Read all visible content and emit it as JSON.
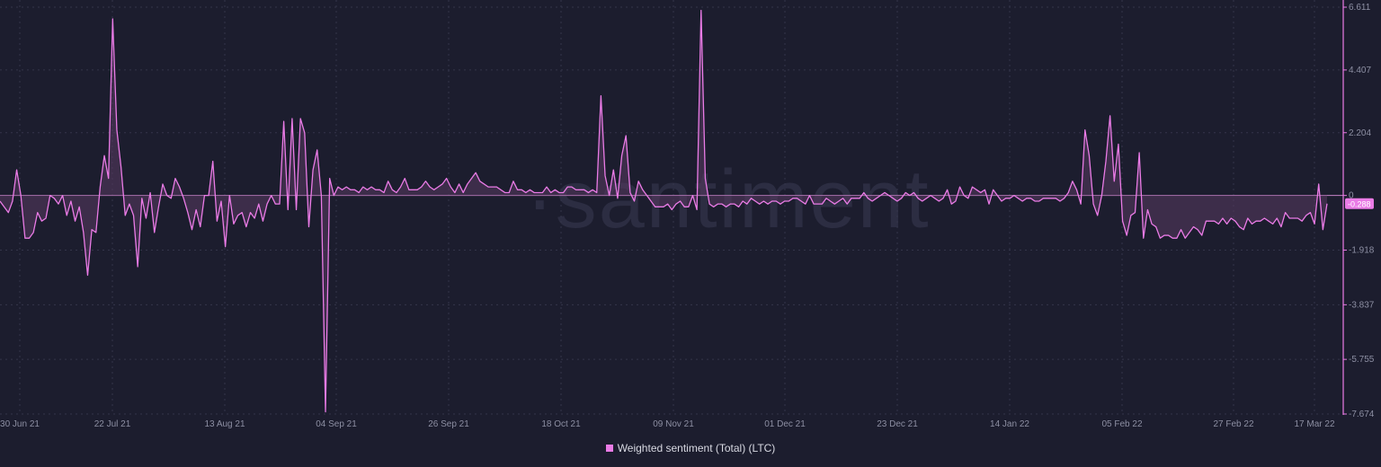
{
  "watermark": "·santiment",
  "legend": {
    "label": "Weighted sentiment (Total) (LTC)"
  },
  "colors": {
    "background": "#1c1d2e",
    "line": "#ea7be6",
    "fill": "#5a3a62",
    "grid": "#34354a",
    "zero_line": "#c583c7",
    "axis": "#ea7be6",
    "last_value_badge": "#ea7be6"
  },
  "chart_data": {
    "type": "area",
    "series": [
      {
        "name": "Weighted sentiment (Total) (LTC)",
        "values": [
          -0.2,
          -0.4,
          -0.6,
          -0.2,
          0.9,
          0.0,
          -1.5,
          -1.5,
          -1.3,
          -0.6,
          -0.9,
          -0.8,
          0.0,
          -0.1,
          -0.3,
          0.0,
          -0.7,
          -0.2,
          -0.9,
          -0.4,
          -1.3,
          -2.8,
          -1.2,
          -1.3,
          0.3,
          1.4,
          0.6,
          6.2,
          2.3,
          1.0,
          -0.7,
          -0.3,
          -0.7,
          -2.5,
          -0.1,
          -0.8,
          0.1,
          -1.3,
          -0.4,
          0.4,
          0.0,
          -0.1,
          0.6,
          0.3,
          -0.1,
          -0.6,
          -1.2,
          -0.5,
          -1.1,
          0.0,
          0.0,
          1.2,
          -0.9,
          -0.2,
          -1.8,
          0.0,
          -1.0,
          -0.7,
          -0.6,
          -1.1,
          -0.6,
          -0.8,
          -0.3,
          -0.9,
          -0.3,
          0.0,
          -0.3,
          -0.3,
          2.6,
          -0.5,
          2.7,
          -0.5,
          2.7,
          2.2,
          -1.1,
          0.9,
          1.6,
          0.0,
          -7.6,
          0.6,
          0.0,
          0.3,
          0.2,
          0.3,
          0.2,
          0.2,
          0.1,
          0.3,
          0.2,
          0.3,
          0.2,
          0.2,
          0.1,
          0.5,
          0.2,
          0.1,
          0.3,
          0.6,
          0.2,
          0.2,
          0.2,
          0.3,
          0.5,
          0.3,
          0.2,
          0.3,
          0.4,
          0.6,
          0.3,
          0.1,
          0.4,
          0.1,
          0.4,
          0.6,
          0.8,
          0.5,
          0.4,
          0.3,
          0.3,
          0.3,
          0.2,
          0.1,
          0.1,
          0.5,
          0.2,
          0.2,
          0.1,
          0.2,
          0.1,
          0.1,
          0.1,
          0.3,
          0.1,
          0.2,
          0.1,
          0.1,
          0.3,
          0.3,
          0.2,
          0.2,
          0.2,
          0.1,
          0.2,
          0.1,
          3.5,
          0.7,
          0.0,
          0.9,
          -0.1,
          1.4,
          2.1,
          0.1,
          -0.2,
          0.5,
          0.2,
          0.0,
          -0.2,
          -0.4,
          -0.4,
          -0.4,
          -0.3,
          -0.5,
          -0.3,
          -0.2,
          -0.4,
          -0.4,
          0.0,
          -0.5,
          6.5,
          0.6,
          -0.3,
          -0.4,
          -0.3,
          -0.3,
          -0.4,
          -0.3,
          -0.3,
          -0.4,
          -0.2,
          -0.3,
          -0.1,
          -0.2,
          -0.3,
          -0.2,
          -0.3,
          -0.2,
          -0.2,
          -0.3,
          -0.2,
          -0.2,
          -0.1,
          -0.1,
          -0.2,
          -0.3,
          0.0,
          -0.3,
          -0.3,
          -0.3,
          -0.1,
          -0.2,
          -0.3,
          -0.2,
          -0.1,
          -0.3,
          -0.1,
          -0.1,
          -0.1,
          0.1,
          -0.1,
          -0.2,
          -0.1,
          0.0,
          0.1,
          0.0,
          -0.1,
          -0.2,
          -0.1,
          0.1,
          0.0,
          0.1,
          -0.1,
          -0.2,
          -0.1,
          0.0,
          -0.1,
          -0.2,
          -0.1,
          0.2,
          -0.3,
          -0.2,
          0.3,
          0.0,
          -0.1,
          0.3,
          0.2,
          0.1,
          0.2,
          -0.3,
          0.2,
          0.0,
          -0.2,
          -0.1,
          -0.1,
          0.0,
          -0.1,
          -0.2,
          -0.1,
          -0.1,
          -0.2,
          -0.2,
          -0.1,
          -0.1,
          -0.1,
          -0.1,
          -0.2,
          -0.1,
          0.1,
          0.5,
          0.2,
          -0.3,
          2.3,
          1.4,
          -0.3,
          -0.7,
          0.0,
          1.2,
          2.8,
          0.5,
          1.8,
          -0.9,
          -1.4,
          -0.7,
          -0.6,
          1.5,
          -1.5,
          -0.5,
          -1.0,
          -1.1,
          -1.5,
          -1.4,
          -1.4,
          -1.5,
          -1.5,
          -1.2,
          -1.5,
          -1.3,
          -1.1,
          -1.2,
          -1.4,
          -0.9,
          -0.9,
          -0.9,
          -1.0,
          -0.8,
          -1.0,
          -0.8,
          -0.9,
          -1.1,
          -1.2,
          -0.8,
          -1.0,
          -0.9,
          -0.9,
          -0.8,
          -0.9,
          -1.0,
          -0.8,
          -1.1,
          -0.6,
          -0.8,
          -0.8,
          -0.8,
          -0.9,
          -0.7,
          -0.6,
          -1.0,
          0.4,
          -1.2,
          -0.288
        ]
      }
    ],
    "x_tick_labels": [
      "30 Jun 21",
      "22 Jul 21",
      "13 Aug 21",
      "04 Sep 21",
      "26 Sep 21",
      "18 Oct 21",
      "09 Nov 21",
      "01 Dec 21",
      "23 Dec 21",
      "14 Jan 22",
      "05 Feb 22",
      "27 Feb 22",
      "17 Mar 22"
    ],
    "y_tick_values": [
      6.611,
      4.407,
      2.204,
      0,
      -1.918,
      -3.837,
      -5.755,
      -7.674
    ],
    "y_tick_labels": [
      "6.611",
      "4.407",
      "2.204",
      "0",
      "-1.918",
      "-3.837",
      "-5.755",
      "-7.674"
    ],
    "ylim": [
      -7.674,
      6.611
    ],
    "last_value": "-0.288",
    "grid": true,
    "y_axis_side": "right",
    "legend_position": "bottom-center"
  }
}
